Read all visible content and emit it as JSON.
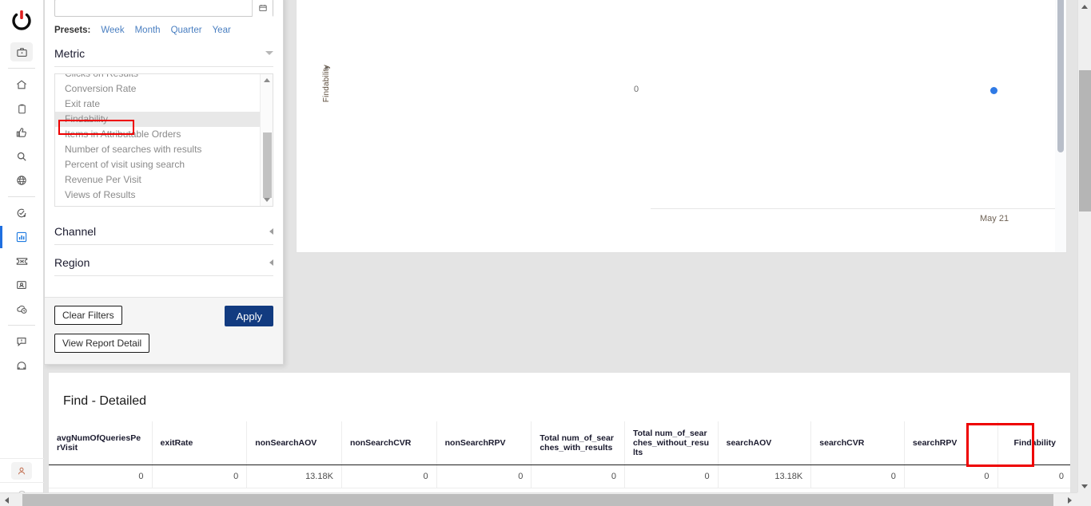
{
  "rail": {
    "logo_name": "power-logo",
    "items": [
      {
        "name": "briefcase-icon",
        "label": "Workspace",
        "state": "boxed"
      },
      {
        "name": "home-icon",
        "label": "Home",
        "state": "normal"
      },
      {
        "name": "clipboard-icon",
        "label": "Tasks",
        "state": "normal"
      },
      {
        "name": "thumbs-up-icon",
        "label": "Recommendations",
        "state": "normal"
      },
      {
        "name": "search-icon",
        "label": "Search",
        "state": "normal"
      },
      {
        "name": "globe-icon",
        "label": "Web",
        "state": "normal"
      },
      {
        "name": "check-circle-plus-icon",
        "label": "Add Task",
        "state": "normal"
      },
      {
        "name": "bar-chart-icon",
        "label": "Reports",
        "state": "active"
      },
      {
        "name": "ticket-icon",
        "label": "Tickets",
        "state": "normal"
      },
      {
        "name": "id-card-icon",
        "label": "Contacts",
        "state": "normal"
      },
      {
        "name": "cloud-clock-icon",
        "label": "Schedule",
        "state": "normal"
      }
    ],
    "bottom_items": [
      {
        "name": "feedback-icon",
        "label": "Feedback",
        "state": "normal"
      },
      {
        "name": "help-icon",
        "label": "Help",
        "state": "normal"
      },
      {
        "name": "user-icon",
        "label": "Account",
        "state": "boxed"
      },
      {
        "name": "copyright-icon",
        "label": "Legal",
        "state": "normal"
      }
    ]
  },
  "filters": {
    "date_value": "",
    "date_placeholder": "",
    "calendar_icon": "calendar-icon",
    "presets_label": "Presets:",
    "presets": [
      "Week",
      "Month",
      "Quarter",
      "Year"
    ],
    "metric": {
      "header": "Metric",
      "options": [
        "Clicks on Results",
        "Conversion Rate",
        "Exit rate",
        "Findability",
        "Items in Attributable Orders",
        "Number of searches with results",
        "Percent of visit using search",
        "Revenue Per Visit",
        "Views of Results"
      ],
      "selected": "Findability",
      "highlight_color": "#ee0000"
    },
    "channel": {
      "header": "Channel"
    },
    "region": {
      "header": "Region"
    },
    "clear_filters_label": "Clear Filters",
    "apply_label": "Apply",
    "apply_color": "#123b80",
    "view_report_detail_label": "View Report Detail"
  },
  "chart_data": {
    "type": "scatter",
    "title": "",
    "xlabel": "",
    "ylabel": "Findability",
    "x": [
      "May 21"
    ],
    "values": [
      0
    ],
    "series": [
      {
        "name": "Findability",
        "values": [
          0
        ],
        "color": "#2f7ae5"
      }
    ],
    "x_tick_labels": [
      "May 21"
    ],
    "y_tick_labels": [
      "0"
    ],
    "ylim": [
      0,
      0
    ],
    "grid": false,
    "legend": "none",
    "point_color": "#2f7ae5"
  },
  "table": {
    "title": "Find - Detailed",
    "highlighted_column": "Findability",
    "highlight_color": "#ee0000",
    "columns": [
      "avgNumOfQueriesPerVisit",
      "exitRate",
      "nonSearchAOV",
      "nonSearchCVR",
      "nonSearchRPV",
      "Total num_of_searches_with_results",
      "Total num_of_searches_without_results",
      "searchAOV",
      "searchCVR",
      "searchRPV",
      "Findability"
    ],
    "rows": [
      [
        "0",
        "0",
        "13.18K",
        "0",
        "0",
        "0",
        "0",
        "13.18K",
        "0",
        "0",
        "0"
      ]
    ]
  },
  "scrollbars": {
    "vertical_name": "page-vertical-scrollbar",
    "horizontal_name": "page-horizontal-scrollbar",
    "chart_inner_name": "chart-vertical-scrollbar",
    "metric_list_name": "metric-list-scrollbar"
  }
}
